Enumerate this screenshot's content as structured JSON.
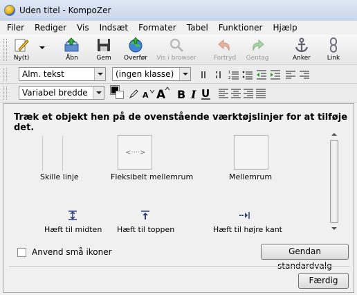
{
  "window": {
    "title": "Uden titel - KompoZer"
  },
  "menu": [
    "Filer",
    "Rediger",
    "Vis",
    "Indsæt",
    "Formater",
    "Tabel",
    "Funktioner",
    "Hjælp"
  ],
  "toolbar": {
    "new": "Ny(t)",
    "open": "Åbn",
    "save": "Gem",
    "publish": "Overfør",
    "browse": "Vis i browser",
    "undo": "Fortryd",
    "redo": "Gentag",
    "anchor": "Anker",
    "link": "Link"
  },
  "format1": {
    "paragraph_style": "Alm. tekst",
    "class": "(ingen klasse)"
  },
  "format2": {
    "font": "Variabel bredde"
  },
  "dialog": {
    "instruction": "Træk et objekt hen på de ovenstående værktøjslinjer for at tilføje det.",
    "items": {
      "separator": "Skille linje",
      "flex_space": "Fleksibelt mellemrum",
      "space": "Mellemrum",
      "spring_center": "Hæft til midten",
      "spring_top": "Hæft til toppen",
      "spring_right": "Hæft til højre kant"
    },
    "small_icons": "Anvend små ikoner",
    "restore_defaults": "Gendan standardvalg",
    "done": "Færdig"
  }
}
